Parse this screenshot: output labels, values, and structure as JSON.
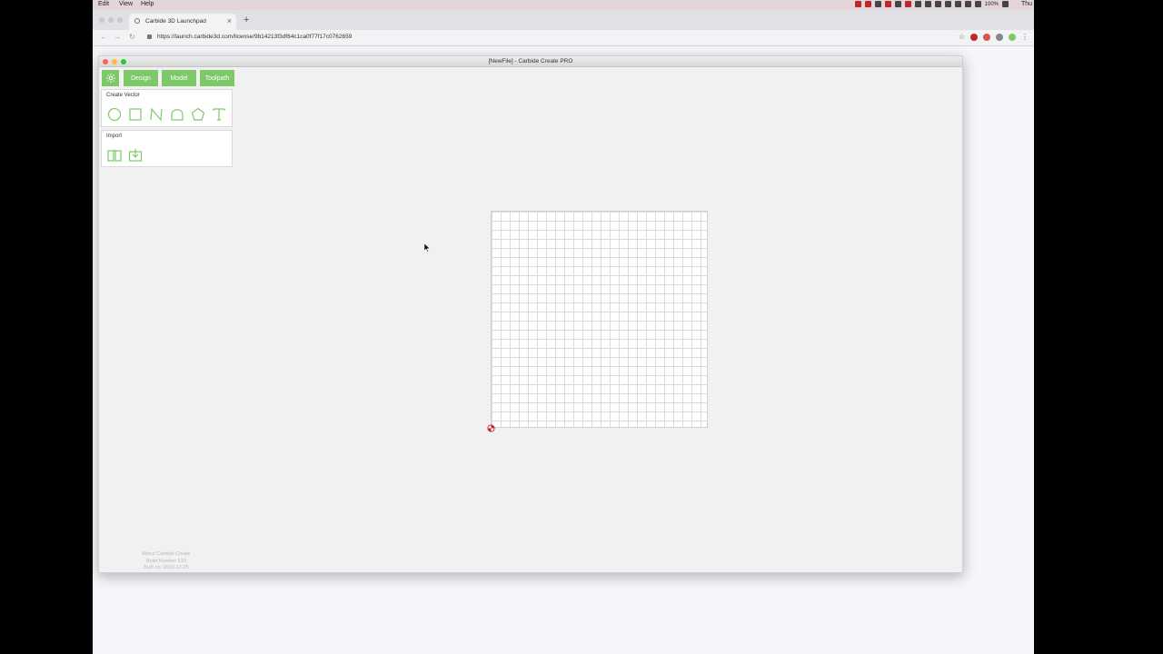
{
  "os": {
    "menus": [
      "Edit",
      "View",
      "Help"
    ],
    "battery": "100%",
    "clock": "Thu"
  },
  "browser": {
    "tab_title": "Carbide 3D Launchpad",
    "tab_close": "×",
    "new_tab": "+",
    "url": "https://launch.carbide3d.com/license/9b14213f3df64c1ca0f77f17c0762659",
    "nav": {
      "back": "←",
      "forward": "→",
      "reload": "↻"
    },
    "bookmark_star": "☆",
    "menu_dots": "⋮",
    "extension_colors": [
      "#c0262b",
      "#d9534f",
      "#888888",
      "#7dc969"
    ]
  },
  "app": {
    "window_title": "[NewFile] - Carbide Create PRO",
    "accent_color": "#7dc969",
    "tabs": [
      {
        "label": "Design"
      },
      {
        "label": "Model"
      },
      {
        "label": "Toolpath"
      }
    ],
    "create_vector": {
      "title": "Create Vector",
      "tools": [
        "circle-icon",
        "rectangle-icon",
        "polyline-icon",
        "curve-icon",
        "polygon-icon",
        "text-icon"
      ]
    },
    "import": {
      "title": "Import",
      "tools": [
        "open-book-icon",
        "import-box-icon"
      ]
    },
    "about": {
      "line1": "About Carbide Create",
      "line2": "Build Number 510",
      "line3": "Built on: 2019-12-25"
    }
  }
}
